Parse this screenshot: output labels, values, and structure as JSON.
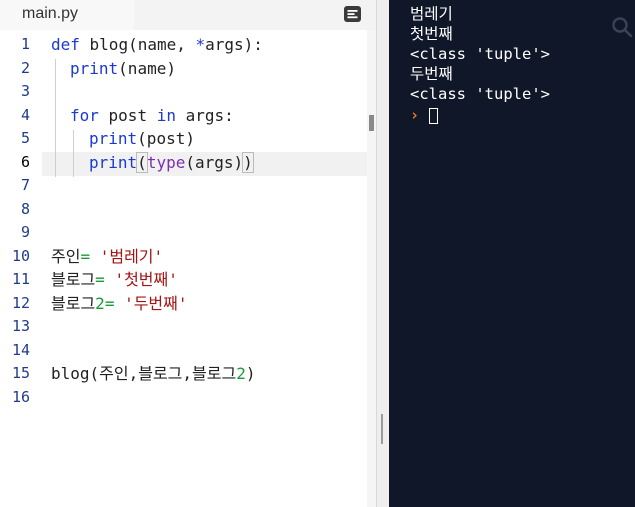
{
  "editor": {
    "tab_label": "main.py",
    "line_numbers": [
      "1",
      "2",
      "3",
      "4",
      "5",
      "6",
      "7",
      "8",
      "9",
      "10",
      "11",
      "12",
      "13",
      "14",
      "15",
      "16"
    ],
    "active_line": 6
  },
  "code_text": {
    "l1_def": "def",
    "l1_rest": " blog(name, ",
    "l1_star": "*",
    "l1_end": "args):",
    "l2_print": "print",
    "l2_rest": "(name)",
    "l4_for": "for",
    "l4_mid": " post ",
    "l4_in": "in",
    "l4_end": " args:",
    "l5_print": "print",
    "l5_rest": "(post)",
    "l6_print": "print",
    "l6_open": "(",
    "l6_type": "type",
    "l6_rest": "(args)",
    "l6_close": ")",
    "l10_var": "주인",
    "l10_eq": "= ",
    "l10_str": "'범레기'",
    "l11_var": "블로그",
    "l11_eq": "= ",
    "l11_str": "'첫번째'",
    "l12_var": "블로그",
    "l12_num": "2",
    "l12_eq": "= ",
    "l12_str": "'두번째'",
    "l15_text": "blog(주인,블로그,블로그",
    "l15_num": "2",
    "l15_close": ")"
  },
  "console": {
    "lines": [
      "범레기",
      "첫번째",
      "<class 'tuple'>",
      "두번째",
      "<class 'tuple'>"
    ],
    "prompt": "›"
  },
  "icons": {
    "menu": "menu-icon",
    "search": "search-icon"
  },
  "colors": {
    "keyword": "#1a3ad1",
    "builtin": "#7a2fb0",
    "string": "#a31515",
    "operator": "#1a9a3a",
    "console_bg": "#0f1729",
    "prompt": "#ff7a1a"
  }
}
